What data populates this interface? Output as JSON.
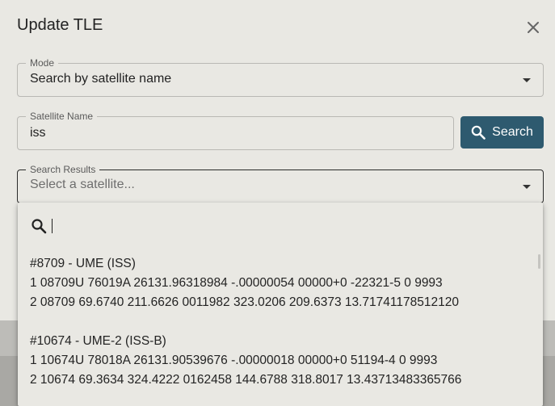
{
  "dialog": {
    "title": "Update TLE",
    "close_icon": "close-icon"
  },
  "mode": {
    "label": "Mode",
    "value": "Search by satellite name"
  },
  "satellite_name": {
    "label": "Satellite Name",
    "value": "iss"
  },
  "search_button": {
    "label": "Search",
    "icon": "search-icon",
    "color": "#2e5a6f"
  },
  "search_results": {
    "label": "Search Results",
    "placeholder": "Select a satellite..."
  },
  "popup": {
    "search_icon": "search-icon",
    "filter_value": "",
    "items": [
      {
        "title": "#8709 - UME (ISS)",
        "line1": "1 08709U 76019A 26131.96318984 -.00000054 00000+0 -22321-5 0 9993",
        "line2": "2 08709 69.6740 211.6626 0011982 323.0206 209.6373 13.71741178512120"
      },
      {
        "title": "#10674 - UME-2 (ISS-B)",
        "line1": "1 10674U 78018A 26131.90539676 -.00000018 00000+0 51194-4 0 9993",
        "line2": "2 10674 69.3634 324.4222 0162458 144.6788 318.8017 13.43713483365766"
      }
    ]
  }
}
